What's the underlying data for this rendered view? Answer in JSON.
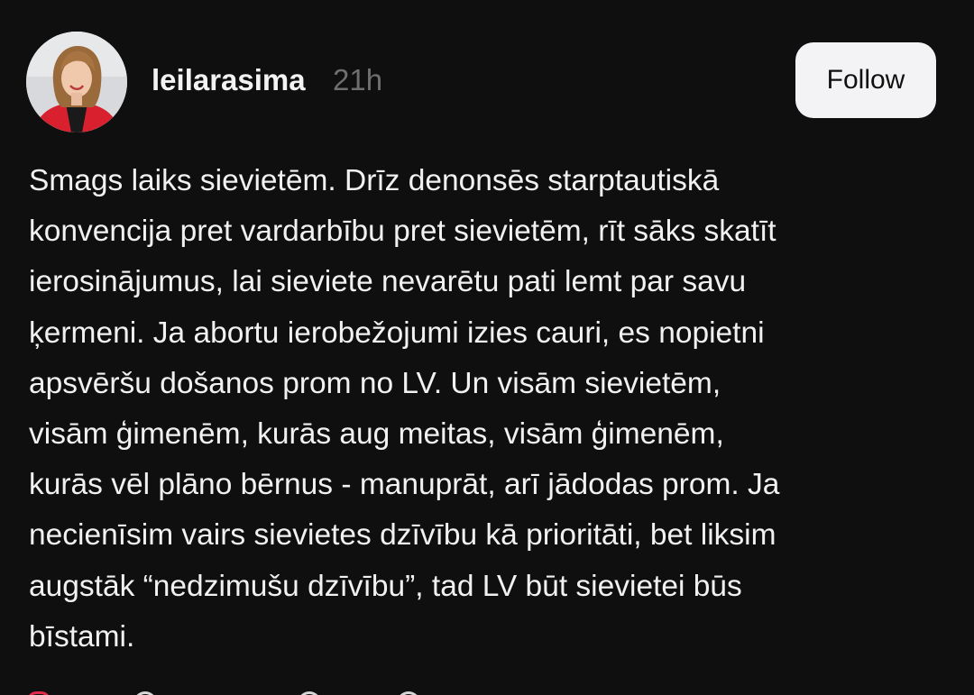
{
  "post": {
    "username": "leilarasima",
    "time": "21h",
    "follow_label": "Follow",
    "lines": [
      "Smags laiks sievietēm. Drīz denonsēs starptautiskā",
      "konvencija pret vardarbību pret sievietēm, rīt sāks skatīt",
      "ierosinājumus, lai sieviete nevarētu pati lemt par savu",
      "ķermeni. Ja abortu ierobežojumi izies cauri, es nopietni",
      "apsvēršu došanos prom no LV. Un visām sievietēm,",
      "visām ģimenēm, kurās aug meitas, visām ģimenēm,",
      "kurās vēl plāno bērnus - manuprāt, arī jādodas prom. Ja",
      "necienīsim vairs sievietes dzīvību kā prioritāti, bet liksim",
      "augstāk “nedzimušu dzīvību”, tad LV būt sievietei būs",
      "bīstami."
    ]
  },
  "actions": {
    "icons": [
      "heart-icon",
      "comment-icon",
      "repost-icon",
      "share-icon"
    ]
  }
}
